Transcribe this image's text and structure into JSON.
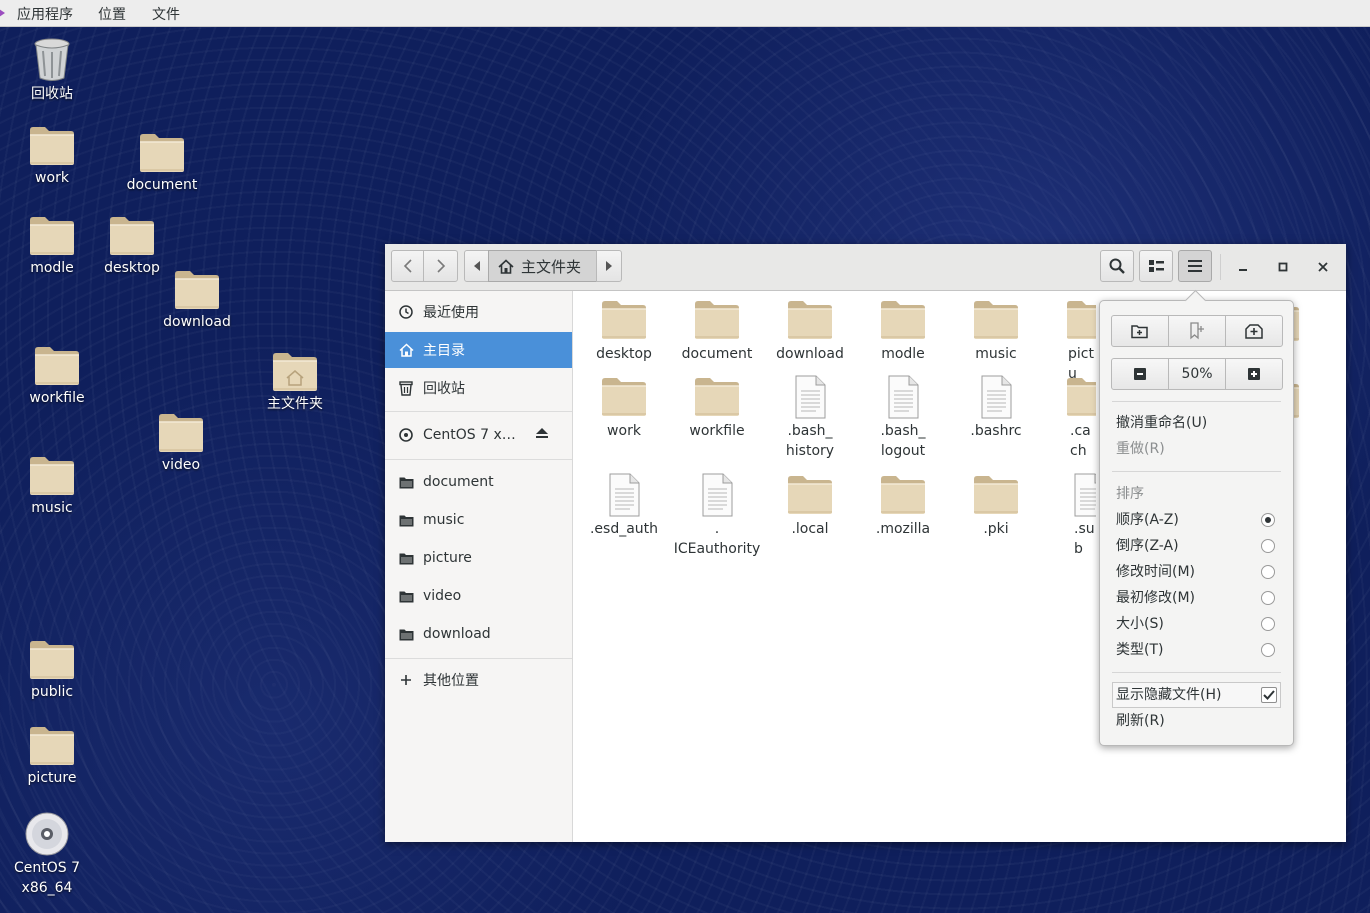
{
  "topbar": {
    "menus": [
      "应用程序",
      "位置",
      "文件"
    ]
  },
  "desktop": {
    "icons": [
      {
        "name": "trash",
        "label": "回收站"
      },
      {
        "name": "work",
        "label": "work"
      },
      {
        "name": "document",
        "label": "document"
      },
      {
        "name": "modle",
        "label": "modle"
      },
      {
        "name": "desktop",
        "label": "desktop"
      },
      {
        "name": "download",
        "label": "download"
      },
      {
        "name": "workfile",
        "label": "workfile"
      },
      {
        "name": "home",
        "label": "主文件夹"
      },
      {
        "name": "video",
        "label": "video"
      },
      {
        "name": "music",
        "label": "music"
      },
      {
        "name": "public",
        "label": "public"
      },
      {
        "name": "picture",
        "label": "picture"
      },
      {
        "name": "centos",
        "label": "CentOS 7\nx86_64",
        "line1": "CentOS 7",
        "line2": "x86_64"
      }
    ]
  },
  "window": {
    "path": {
      "current": "主文件夹"
    },
    "sidebar": {
      "recent": "最近使用",
      "home": "主目录",
      "trash": "回收站",
      "device": "CentOS 7 x…",
      "bookmarks": [
        "document",
        "music",
        "picture",
        "video",
        "download"
      ],
      "other": "其他位置"
    },
    "files": [
      {
        "label": "desktop",
        "kind": "folder"
      },
      {
        "label": "document",
        "kind": "folder"
      },
      {
        "label": "download",
        "kind": "folder"
      },
      {
        "label": "modle",
        "kind": "folder"
      },
      {
        "label": "music",
        "kind": "folder"
      },
      {
        "label": "pictu",
        "kind": "folder"
      },
      {
        "label": "work",
        "kind": "folder"
      },
      {
        "label": "workfile",
        "kind": "folder"
      },
      {
        "label": ".bash_\nhistory",
        "line1": ".bash_",
        "line2": "history",
        "kind": "file"
      },
      {
        "label": ".bash_\nlogout",
        "line1": ".bash_",
        "line2": "logout",
        "kind": "file"
      },
      {
        "label": ".bashrc",
        "kind": "file"
      },
      {
        "label": ".cach",
        "kind": "folder"
      },
      {
        "label": ".esd_auth",
        "kind": "file"
      },
      {
        "label": ".\nICEauthority",
        "line1": ".",
        "line2": "ICEauthority",
        "kind": "file"
      },
      {
        "label": ".local",
        "kind": "folder"
      },
      {
        "label": ".mozilla",
        "kind": "folder"
      },
      {
        "label": ".pki",
        "kind": "folder"
      },
      {
        "label": ".sub",
        "kind": "file"
      }
    ]
  },
  "popover": {
    "zoom": "50%",
    "undo": "撤消重命名(U)",
    "redo": "重做(R)",
    "sort_heading": "排序",
    "sort_options": [
      {
        "label": "顺序(A-Z)",
        "selected": true
      },
      {
        "label": "倒序(Z-A)",
        "selected": false
      },
      {
        "label": "修改时间(M)",
        "selected": false
      },
      {
        "label": "最初修改(M)",
        "selected": false
      },
      {
        "label": "大小(S)",
        "selected": false
      },
      {
        "label": "类型(T)",
        "selected": false
      }
    ],
    "show_hidden": "显示隐藏文件(H)",
    "show_hidden_checked": true,
    "refresh": "刷新(R)"
  },
  "colors": {
    "desktop_bg": "#0f1f5c",
    "selection": "#4a90d9",
    "folder": "#e3d3b3"
  }
}
